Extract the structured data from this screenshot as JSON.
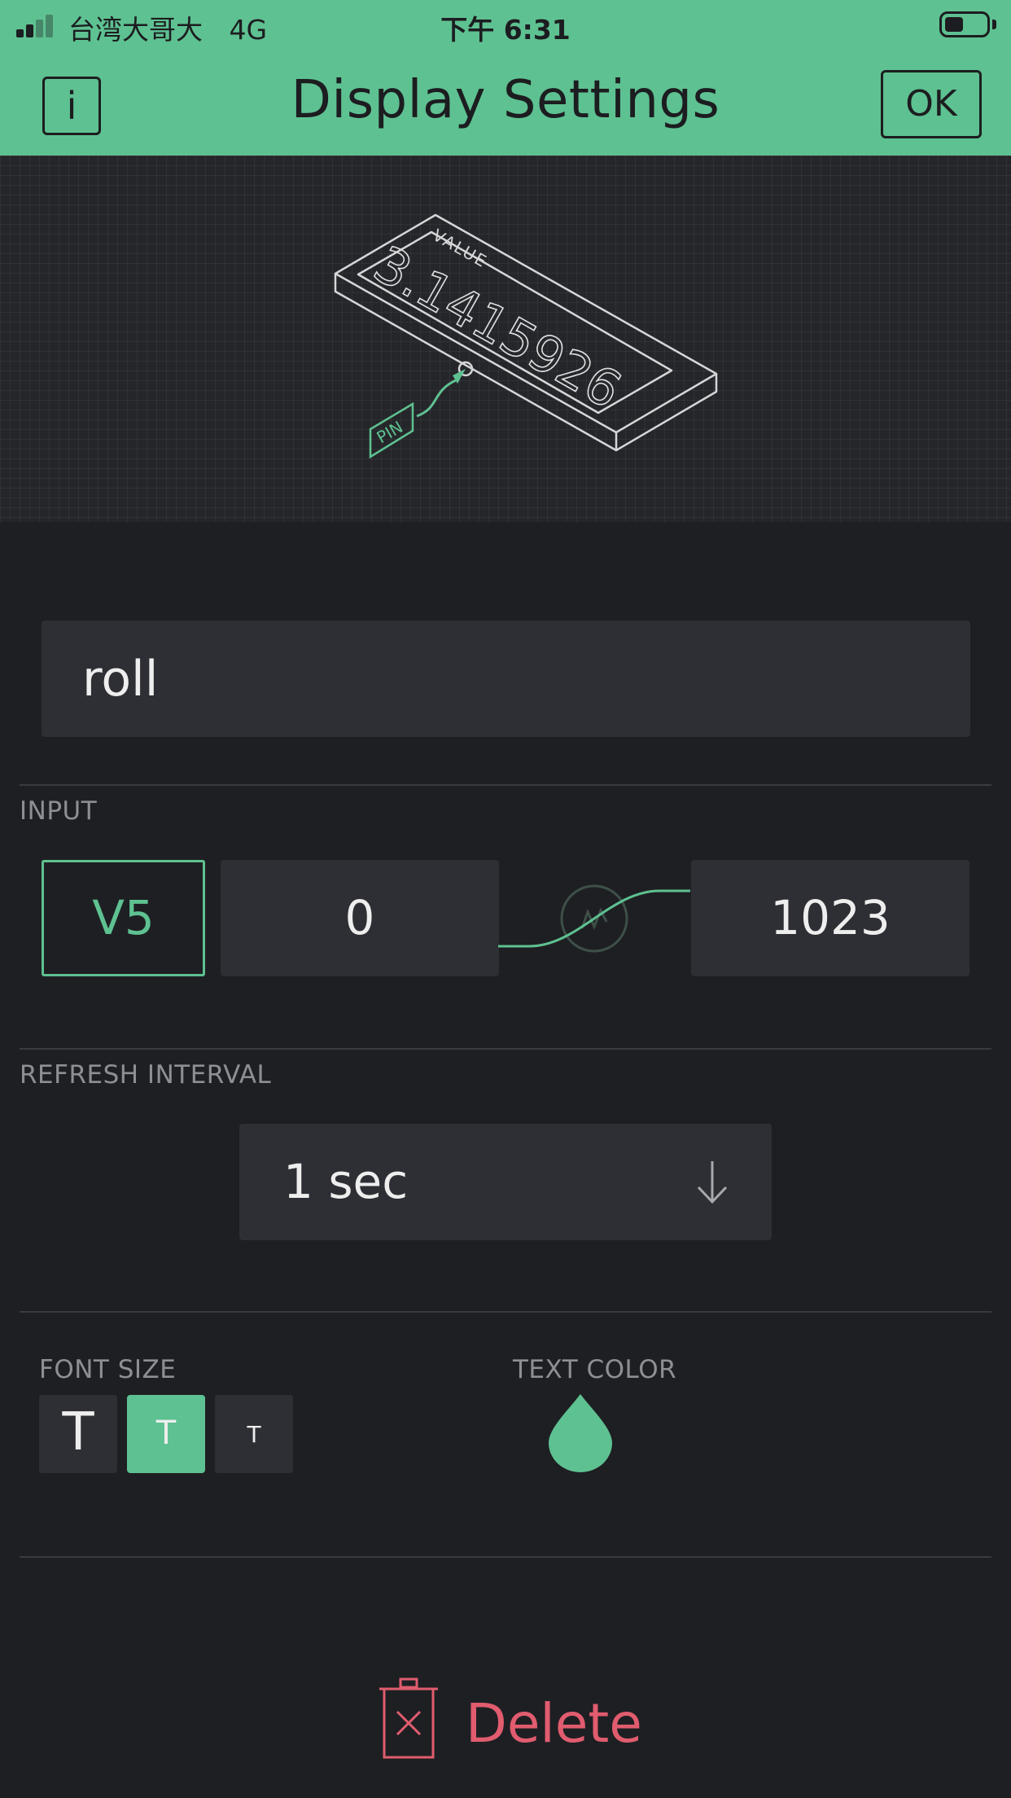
{
  "status_bar": {
    "carrier": "台湾大哥大",
    "network": "4G",
    "time": "下午 6:31"
  },
  "header": {
    "info_label": "i",
    "title": "Display Settings",
    "ok_label": "OK"
  },
  "preview": {
    "value_caption": "VALUE",
    "sample_value": "3.1415926",
    "pin_caption": "PIN"
  },
  "name_field": {
    "value": "roll"
  },
  "input": {
    "section_label": "INPUT",
    "pin": "V5",
    "min": "0",
    "max": "1023"
  },
  "refresh": {
    "section_label": "REFRESH INTERVAL",
    "selected": "1 sec"
  },
  "font_size": {
    "section_label": "FONT SIZE",
    "options": [
      "T",
      "T",
      "T"
    ],
    "selected_index": 1
  },
  "text_color": {
    "section_label": "TEXT COLOR",
    "value": "#5ec191"
  },
  "delete": {
    "label": "Delete"
  },
  "colors": {
    "accent": "#5ec191",
    "background": "#1e1f23",
    "field": "#2e2f34",
    "danger": "#e05c6e"
  }
}
